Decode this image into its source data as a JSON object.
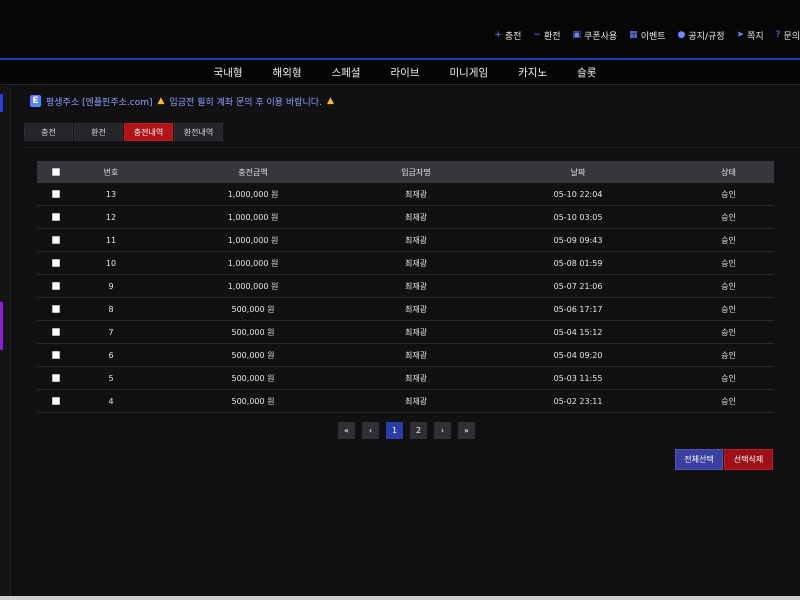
{
  "util_nav": [
    {
      "icon": "plus-icon",
      "glyph": "+",
      "label": "충전"
    },
    {
      "icon": "minus-icon",
      "glyph": "−",
      "label": "환전"
    },
    {
      "icon": "gift-icon",
      "glyph": "▣",
      "label": "쿠폰사용"
    },
    {
      "icon": "calendar-icon",
      "glyph": "▦",
      "label": "이벤트"
    },
    {
      "icon": "info-icon",
      "glyph": "●",
      "label": "공지/규정"
    },
    {
      "icon": "send-icon",
      "glyph": "➤",
      "label": "쪽지"
    },
    {
      "icon": "question-icon",
      "glyph": "?",
      "label": "문의"
    }
  ],
  "main_nav": [
    "국내형",
    "해외형",
    "스페셜",
    "라이브",
    "미니게임",
    "카지노",
    "슬롯"
  ],
  "notice": {
    "logo": "E",
    "site_text": "평생주소 [엔플핀주소.com]",
    "warning_text": "입금전 필히 계좌 문의 후 이용 바랍니다."
  },
  "tabs": [
    {
      "label": "충전",
      "active": false
    },
    {
      "label": "환전",
      "active": false
    },
    {
      "label": "충전내역",
      "active": true
    },
    {
      "label": "환전내역",
      "active": false
    }
  ],
  "table": {
    "headers": {
      "no": "번호",
      "amount": "충전금액",
      "depositor": "입금자명",
      "date": "날짜",
      "status": "상태"
    },
    "rows": [
      {
        "no": "13",
        "amount": "1,000,000 원",
        "depositor": "최재광",
        "date": "05-10 22:04",
        "status": "승인"
      },
      {
        "no": "12",
        "amount": "1,000,000 원",
        "depositor": "최재광",
        "date": "05-10 03:05",
        "status": "승인"
      },
      {
        "no": "11",
        "amount": "1,000,000 원",
        "depositor": "최재광",
        "date": "05-09 09:43",
        "status": "승인"
      },
      {
        "no": "10",
        "amount": "1,000,000 원",
        "depositor": "최재광",
        "date": "05-08 01:59",
        "status": "승인"
      },
      {
        "no": "9",
        "amount": "1,000,000 원",
        "depositor": "최재광",
        "date": "05-07 21:06",
        "status": "승인"
      },
      {
        "no": "8",
        "amount": "500,000 원",
        "depositor": "최재광",
        "date": "05-06 17:17",
        "status": "승인"
      },
      {
        "no": "7",
        "amount": "500,000 원",
        "depositor": "최재광",
        "date": "05-04 15:12",
        "status": "승인"
      },
      {
        "no": "6",
        "amount": "500,000 원",
        "depositor": "최재광",
        "date": "05-04 09:20",
        "status": "승인"
      },
      {
        "no": "5",
        "amount": "500,000 원",
        "depositor": "최재광",
        "date": "05-03 11:55",
        "status": "승인"
      },
      {
        "no": "4",
        "amount": "500,000 원",
        "depositor": "최재광",
        "date": "05-02 23:11",
        "status": "승인"
      }
    ]
  },
  "pagination": {
    "first": "«",
    "prev": "‹",
    "next": "›",
    "last": "»",
    "pages": [
      "1",
      "2"
    ],
    "current": "1"
  },
  "actions": {
    "select_all": "전체선택",
    "delete_selected": "선택삭제"
  },
  "colors": {
    "accent_blue": "#1d3fbf",
    "active_tab": "#b3121a",
    "warning": "#ffbf1a"
  }
}
